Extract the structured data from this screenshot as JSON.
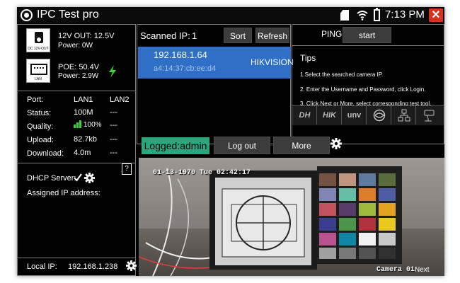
{
  "status_bar": {
    "app_title": "IPC Test pro",
    "time": "7:13 PM",
    "icons": [
      "app-camera-icon",
      "sd-card-icon",
      "wifi-icon",
      "battery-icon",
      "close-icon"
    ],
    "close_symbol": "✕"
  },
  "power": {
    "dc_label": "12V OUT: 12.5V",
    "dc_power": "Power: 0W",
    "dc_icon_caption": "DC 12V-OUT",
    "poe_label": "POE: 50.4V",
    "poe_power": "Power: 2.9W",
    "lan_icon_caption": "LAN"
  },
  "ports": {
    "header": [
      "Port:",
      "LAN1",
      "LAN2"
    ],
    "rows": [
      {
        "label": "Status:",
        "lan1": "100M",
        "lan2": "---"
      },
      {
        "label": "Quality:",
        "lan1": "100%",
        "lan2": "---"
      },
      {
        "label": "Upload:",
        "lan1": "82.7kb",
        "lan2": "---"
      },
      {
        "label": "Download:",
        "lan1": "4.0m",
        "lan2": "---"
      }
    ]
  },
  "dhcp": {
    "label": "DHCP Server:",
    "checked": true,
    "help": "?",
    "assigned_label": "Assigned IP address:"
  },
  "local_ip": {
    "label": "Local IP:",
    "value": "192.168.1.238"
  },
  "scan": {
    "label": "Scanned IP:",
    "count": "1",
    "sort_label": "Sort",
    "refresh_label": "Refresh",
    "devices": [
      {
        "ip": "192.168.1.64",
        "mac": "a4:14:37:cb:ee:d4",
        "vendor": "HIKVISION"
      }
    ]
  },
  "ping": {
    "label": "PING",
    "start_label": "start"
  },
  "tips": {
    "title": "Tips",
    "items": [
      "1.Select the searched camera IP.",
      "2. Enter the Username and Password, click Login.",
      "3. Click Next or More, select corresponding test tool."
    ]
  },
  "brands": [
    {
      "name": "DH",
      "kind": "text"
    },
    {
      "name": "HIK",
      "kind": "text"
    },
    {
      "name": "unv",
      "kind": "text"
    },
    {
      "name": "onvif-icon",
      "kind": "icon"
    },
    {
      "name": "network-icon",
      "kind": "icon"
    },
    {
      "name": "rtsp-camera-icon",
      "kind": "icon"
    }
  ],
  "actions": {
    "logged_label": "Logged:admin",
    "logout_label": "Log out",
    "more_label": "More"
  },
  "camera": {
    "timestamp": "01-13-1970 Tue 02:42:17",
    "name": "Camera 01",
    "next_label": "Next"
  },
  "colors": {
    "accent_blue": "#2f6fc6",
    "logged_green": "#2aa77f",
    "close_red": "#d9301f",
    "signal_green": "#3bd23b",
    "bolt_green": "#37d42f"
  }
}
